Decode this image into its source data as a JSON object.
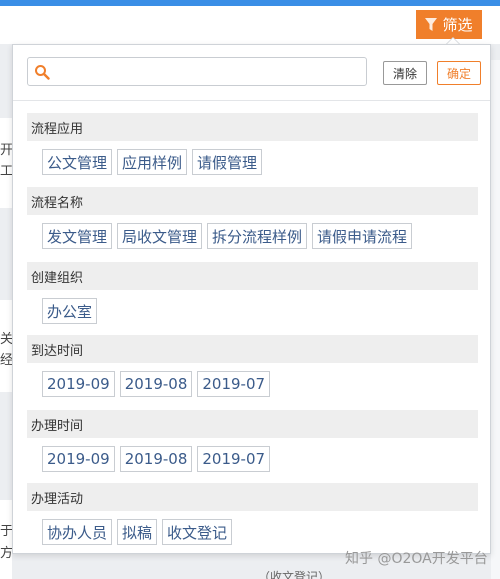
{
  "header": {
    "filter_label": "筛选"
  },
  "background": {
    "snippets": [
      "开",
      "工",
      "关",
      "经",
      "于",
      "方"
    ],
    "bottom_text": "（收文登记）"
  },
  "panel": {
    "search": {
      "value": "",
      "placeholder": ""
    },
    "clear_label": "清除",
    "confirm_label": "确定",
    "sections": [
      {
        "title": "流程应用",
        "options": [
          "公文管理",
          "应用样例",
          "请假管理"
        ]
      },
      {
        "title": "流程名称",
        "options": [
          "发文管理",
          "局收文管理",
          "拆分流程样例",
          "请假申请流程"
        ]
      },
      {
        "title": "创建组织",
        "options": [
          "办公室"
        ]
      },
      {
        "title": "到达时间",
        "options": [
          "2019-09",
          "2019-08",
          "2019-07"
        ]
      },
      {
        "title": "办理时间",
        "options": [
          "2019-09",
          "2019-08",
          "2019-07"
        ]
      },
      {
        "title": "办理活动",
        "options": [
          "协办人员",
          "拟稿",
          "收文登记"
        ]
      }
    ]
  },
  "watermark": "知乎 @O2OA开发平台",
  "colors": {
    "accent": "#f07f2b",
    "chip_text": "#3b5b8a",
    "topbar": "#3a8ee6"
  }
}
